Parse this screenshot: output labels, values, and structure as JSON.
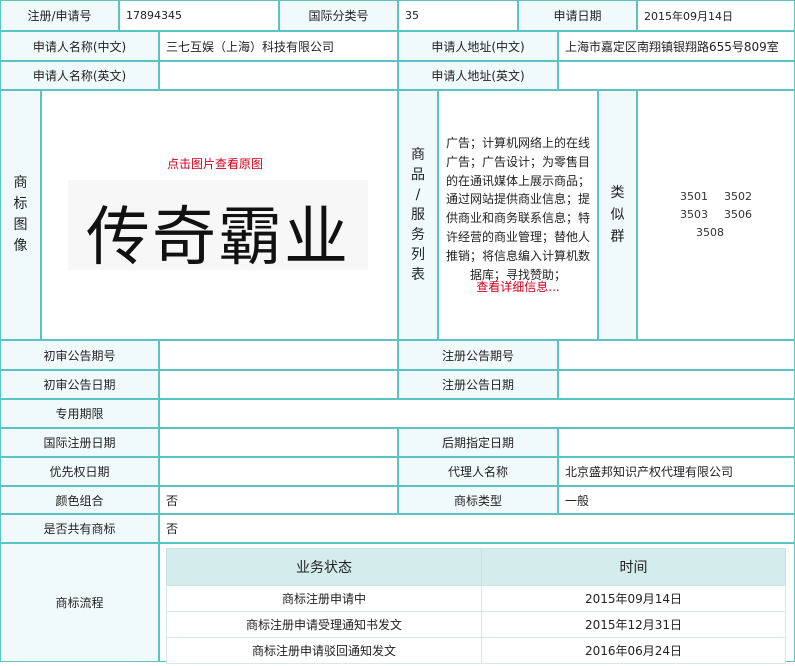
{
  "row1": {
    "reg_no_label": "注册/申请号",
    "reg_no_value": "17894345",
    "class_label": "国际分类号",
    "class_value": "35",
    "apply_date_label": "申请日期",
    "apply_date_value": "2015年09月14日"
  },
  "applicant": {
    "name_cn_label": "申请人名称(中文)",
    "name_cn_value": "三七互娱（上海）科技有限公司",
    "addr_cn_label": "申请人地址(中文)",
    "addr_cn_value": "上海市嘉定区南翔镇银翔路655号809室",
    "name_en_label": "申请人名称(英文)",
    "addr_en_label": "申请人地址(英文)"
  },
  "mark": {
    "image_label": "商标图像",
    "view_original": "点击图片查看原图",
    "mark_text": "传奇霸业",
    "goods_label": "商品/服务列表",
    "goods_lines": [
      "广告；计算机网络上的在线",
      "广告；广告设计；为零售目",
      "的在通讯媒体上展示商品；",
      "通过网站提供商业信息；提",
      "供商业和商务联系信息；特",
      "许经营的商业管理；替他人",
      "推销；将信息编入计算机数",
      "据库；寻找赞助；"
    ],
    "more_link": "查看详细信息...",
    "similar_label": "类似群",
    "similar_groups": [
      "3501",
      "3502",
      "3503",
      "3506",
      "3508"
    ]
  },
  "fields": {
    "prelim_pub_no_label": "初审公告期号",
    "reg_pub_no_label": "注册公告期号",
    "prelim_pub_date_label": "初审公告日期",
    "reg_pub_date_label": "注册公告日期",
    "exclusive_label": "专用期限",
    "intl_reg_date_label": "国际注册日期",
    "later_designation_label": "后期指定日期",
    "priority_date_label": "优先权日期",
    "agent_label": "代理人名称",
    "agent_value": "北京盛邦知识产权代理有限公司",
    "color_label": "颜色组合",
    "color_value": "否",
    "mark_type_label": "商标类型",
    "mark_type_value": "一般",
    "shared_label": "是否共有商标",
    "shared_value": "否",
    "flow_label": "商标流程"
  },
  "flow": {
    "headers": [
      "业务状态",
      "时间"
    ],
    "rows": [
      {
        "status": "商标注册申请中",
        "date": "2015年09月14日"
      },
      {
        "status": "商标注册申请受理通知书发文",
        "date": "2015年12月31日"
      },
      {
        "status": "商标注册申请驳回通知发文",
        "date": "2016年06月24日"
      }
    ]
  }
}
